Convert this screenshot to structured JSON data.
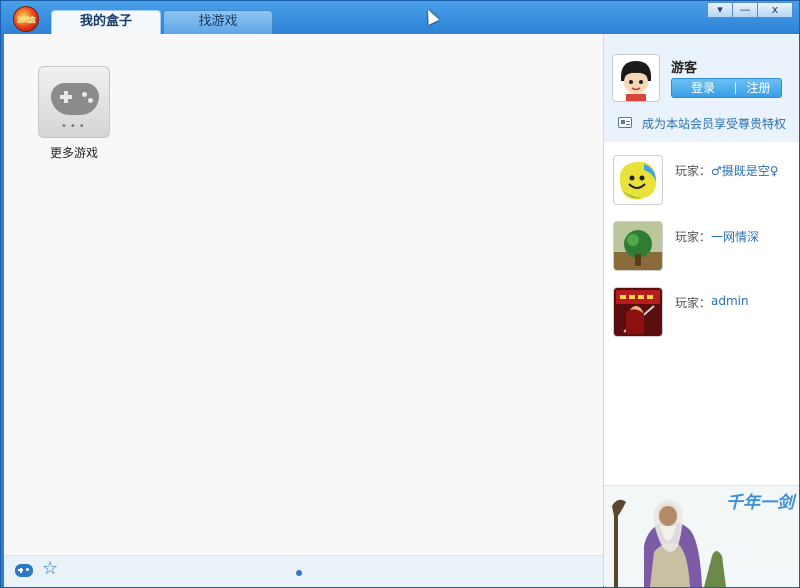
{
  "app": {
    "tabs": [
      {
        "label": "我的盒子",
        "active": true
      },
      {
        "label": "找游戏",
        "active": false
      }
    ],
    "window_buttons": {
      "menu": "▾",
      "minimize": "—",
      "close": "x"
    },
    "logo_text": "游戏盒"
  },
  "main": {
    "games": [
      {
        "label": "更多游戏",
        "icon": "gamepad-icon"
      }
    ]
  },
  "bottom_bar": {
    "icons": [
      "gamepad-icon",
      "star-icon"
    ],
    "page_indicator": {
      "pages": 1,
      "current": 1
    }
  },
  "sidebar": {
    "user": {
      "name": "游客",
      "login_label": "登录",
      "separator": "|",
      "register_label": "注册",
      "member_promo": "成为本站会员享受尊贵特权"
    },
    "players": [
      {
        "prefix": "玩家：",
        "name": "♂摄既是空♀",
        "thumb": "yellow-face"
      },
      {
        "prefix": "玩家：",
        "name": "一网情深",
        "thumb": "green-tree"
      },
      {
        "prefix": "玩家：",
        "name": "admin",
        "thumb": "red-warrior"
      }
    ],
    "banner_text": "千年一剑"
  },
  "colors": {
    "titlebar": "#2d82d6",
    "accent": "#2d79c8",
    "link": "#2a6fb3",
    "main_bg": "#f8f8f8"
  }
}
